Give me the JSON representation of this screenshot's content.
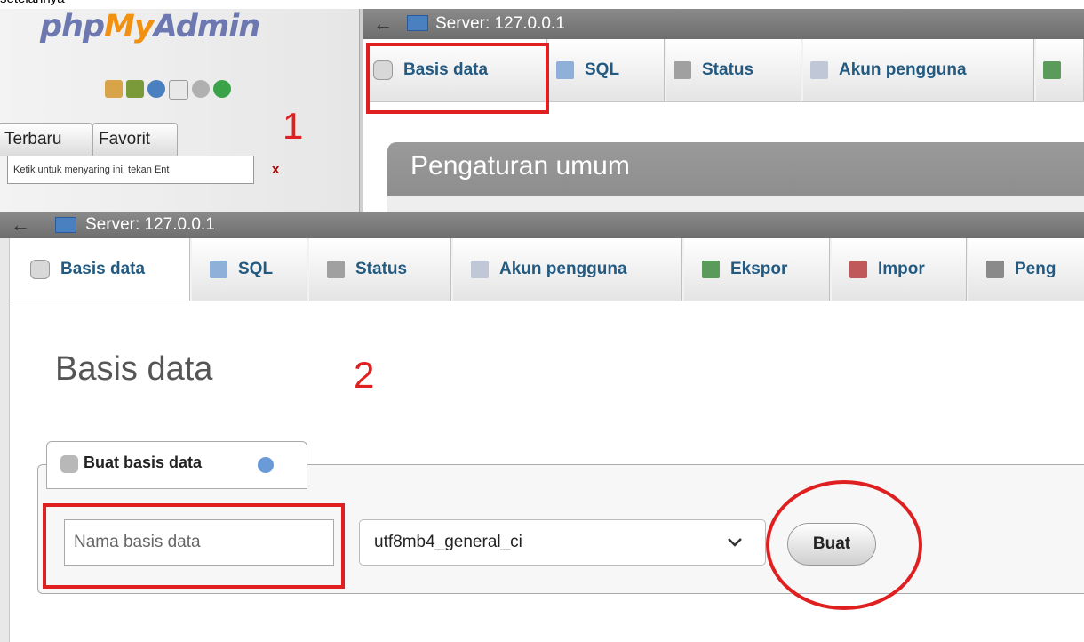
{
  "top_snippet": "setelahnya",
  "sidebar": {
    "logo_php": "php",
    "logo_my": "My",
    "logo_admin": "Admin",
    "tabs": [
      "Terbaru",
      "Favorit"
    ],
    "filter_placeholder": "Ketik untuk menyaring ini, tekan Ent",
    "filter_clear": "x"
  },
  "annotations": {
    "step1": "1",
    "step2": "2"
  },
  "shot1": {
    "back_arrow": "←",
    "server_label": "Server: 127.0.0.1",
    "tabs": [
      "Basis data",
      "SQL",
      "Status",
      "Akun pengguna"
    ],
    "panel_title": "Pengaturan umum"
  },
  "shot2": {
    "back_arrow": "←",
    "server_label": "Server: 127.0.0.1",
    "tabs": [
      "Basis data",
      "SQL",
      "Status",
      "Akun pengguna",
      "Ekspor",
      "Impor",
      "Peng"
    ],
    "heading": "Basis data",
    "create_tab_label": "Buat basis data",
    "name_placeholder": "Nama basis data",
    "collation_value": "utf8mb4_general_ci",
    "create_button": "Buat"
  },
  "colors": {
    "highlight": "#e02020",
    "tab_text": "#235a81",
    "logo_blue": "#6c78af",
    "logo_orange": "#f29111"
  }
}
